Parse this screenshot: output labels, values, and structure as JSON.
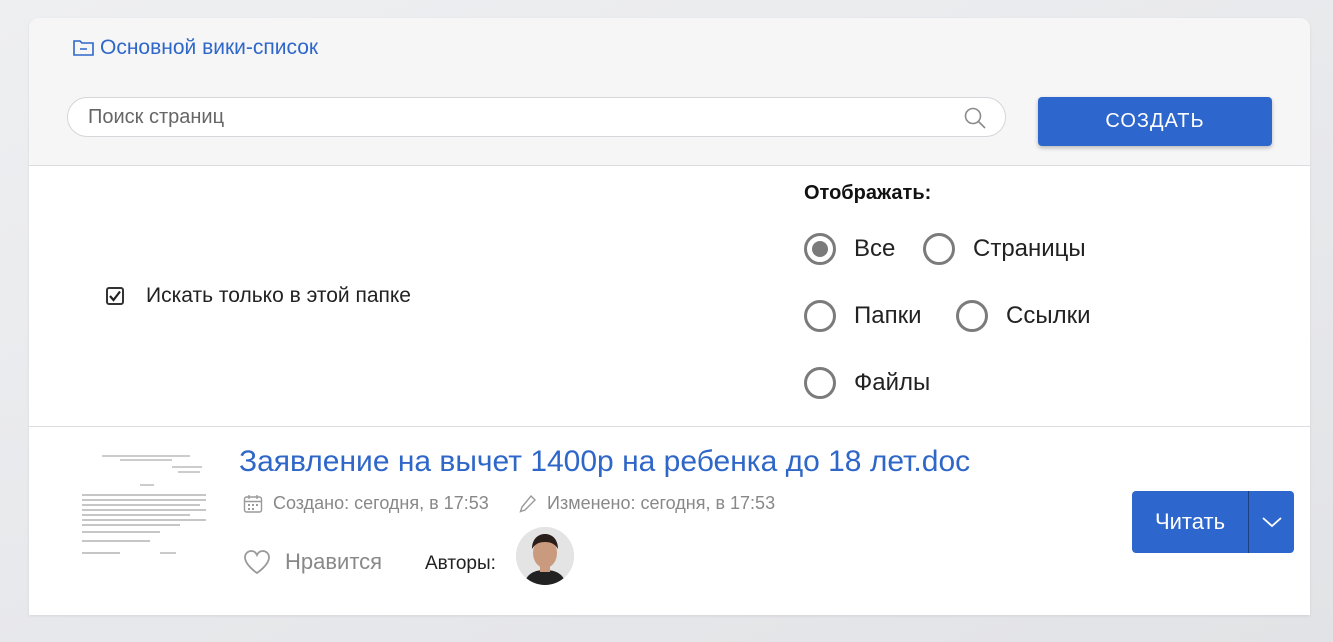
{
  "breadcrumb": {
    "label": "Основной вики-список",
    "icon": "folder-icon"
  },
  "search": {
    "placeholder": "Поиск страниц",
    "value": ""
  },
  "create_button": {
    "label": "СОЗДАТЬ"
  },
  "filters": {
    "folder_only": {
      "label": "Искать только в этой папке",
      "checked": true
    },
    "display_title": "Отображать:",
    "options": [
      {
        "label": "Все",
        "selected": true
      },
      {
        "label": "Страницы",
        "selected": false
      },
      {
        "label": "Папки",
        "selected": false
      },
      {
        "label": "Ссылки",
        "selected": false
      },
      {
        "label": "Файлы",
        "selected": false
      }
    ]
  },
  "item": {
    "title": "Заявление на вычет 1400р на ребенка до 18 лет.doc",
    "created": "Создано: сегодня, в 17:53",
    "modified": "Изменено: сегодня, в 17:53",
    "like_label": "Нравится",
    "authors_label": "Авторы:",
    "read_button": "Читать"
  },
  "colors": {
    "accent": "#2d66cc",
    "link": "#2f67c8"
  }
}
